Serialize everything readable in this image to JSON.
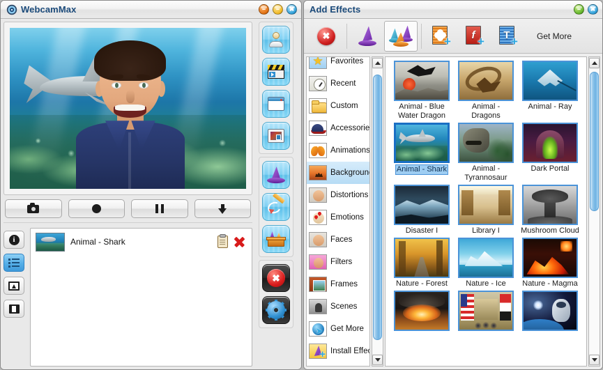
{
  "main_window": {
    "title": "WebcamMax",
    "logo_icon": "webcam-logo-icon",
    "window_buttons": [
      {
        "name": "minimize-button",
        "color": "#e06f10",
        "glyph": "–"
      },
      {
        "name": "maximize-button",
        "color": "#f0b824",
        "glyph": "–"
      },
      {
        "name": "close-button",
        "color": "#2f9fd8",
        "glyph": "✖"
      }
    ],
    "transport_buttons": [
      {
        "name": "snapshot-button",
        "icon": "camera-icon"
      },
      {
        "name": "record-button",
        "icon": "record-circle-icon"
      },
      {
        "name": "pause-button",
        "icon": "pause-icon"
      },
      {
        "name": "download-button",
        "icon": "arrow-down-icon"
      }
    ],
    "list_side_buttons": [
      {
        "name": "info-button",
        "icon": "info-icon",
        "active": false
      },
      {
        "name": "effects-list-button",
        "icon": "list-icon",
        "active": true
      },
      {
        "name": "image-button",
        "icon": "picture-icon",
        "active": false
      },
      {
        "name": "video-button",
        "icon": "film-icon",
        "active": false
      }
    ],
    "applied_effects": [
      {
        "name": "Animal - Shark",
        "thumb": "shark-thumb",
        "settings_icon": "clipboard-icon",
        "remove_icon": "red-x-icon"
      }
    ],
    "vertical_toolbar_groups": [
      [
        {
          "name": "avatar-button",
          "icon": "avatar-icon"
        },
        {
          "name": "video-clip-button",
          "icon": "clapperboard-icon"
        },
        {
          "name": "desktop-window-button",
          "icon": "window-icon"
        },
        {
          "name": "picture-in-picture-button",
          "icon": "frame-picture-icon"
        }
      ],
      [
        {
          "name": "effects-button",
          "icon": "magic-hat-icon"
        },
        {
          "name": "doodle-button",
          "icon": "pencil-icon"
        },
        {
          "name": "my-effects-button",
          "icon": "toolbox-icon"
        }
      ],
      [
        {
          "name": "stop-all-button",
          "icon": "red-stop-icon"
        },
        {
          "name": "settings-button",
          "icon": "gear-icon"
        }
      ]
    ]
  },
  "effects_window": {
    "title": "Add Effects",
    "window_buttons": [
      {
        "name": "minimize-button",
        "color": "#62b42a",
        "glyph": "–"
      },
      {
        "name": "close-button",
        "color": "#2f9fd8",
        "glyph": "✖"
      }
    ],
    "toolbar": {
      "items": [
        {
          "name": "clear-effects-button",
          "icon": "red-stop-icon",
          "selected": false
        },
        {
          "name": "single-effect-button",
          "icon": "single-hat-icon",
          "selected": false
        },
        {
          "name": "multi-effect-button",
          "icon": "multi-hat-icon",
          "selected": true
        },
        {
          "name": "add-picture-button",
          "icon": "add-image-icon",
          "selected": false
        },
        {
          "name": "add-flash-button",
          "icon": "add-flash-icon",
          "selected": false
        },
        {
          "name": "add-text-button",
          "icon": "add-text-icon",
          "selected": false
        }
      ],
      "get_more_label": "Get More"
    },
    "categories": [
      {
        "label": "Favorites",
        "icon": "star-icon",
        "active": false
      },
      {
        "label": "Recent",
        "icon": "clock-icon",
        "active": false
      },
      {
        "label": "Custom",
        "icon": "folder-icon",
        "active": false
      },
      {
        "label": "Accessories",
        "icon": "cap-icon",
        "active": false
      },
      {
        "label": "Animations",
        "icon": "butterfly-icon",
        "active": false
      },
      {
        "label": "Backgrounds",
        "icon": "desert-icon",
        "active": true
      },
      {
        "label": "Distortions",
        "icon": "face-icon",
        "active": false
      },
      {
        "label": "Emotions",
        "icon": "emotion-icon",
        "active": false
      },
      {
        "label": "Faces",
        "icon": "faces-icon",
        "active": false
      },
      {
        "label": "Filters",
        "icon": "filter-icon",
        "active": false
      },
      {
        "label": "Frames",
        "icon": "frame-icon",
        "active": false
      },
      {
        "label": "Scenes",
        "icon": "scene-icon",
        "active": false
      },
      {
        "label": "Get More",
        "icon": "globe-icon",
        "active": false
      },
      {
        "label": "Install Effects",
        "icon": "install-hat-icon",
        "active": false
      }
    ],
    "effects": [
      {
        "label": "Animal - Blue Water Dragon",
        "art": "a-dragon",
        "selected": false
      },
      {
        "label": "Animal - Dragons",
        "art": "a-dragons",
        "selected": false
      },
      {
        "label": "Animal - Ray",
        "art": "a-ray",
        "selected": false
      },
      {
        "label": "Animal - Shark",
        "art": "a-shark",
        "selected": true
      },
      {
        "label": "Animal - Tyrannosaur",
        "art": "a-trex",
        "selected": false
      },
      {
        "label": "Dark Portal",
        "art": "a-portal",
        "selected": false
      },
      {
        "label": "Disaster I",
        "art": "a-disaster",
        "selected": false
      },
      {
        "label": "Library I",
        "art": "a-library",
        "selected": false
      },
      {
        "label": "Mushroom Cloud",
        "art": "a-mush",
        "selected": false
      },
      {
        "label": "Nature - Forest",
        "art": "a-forest",
        "selected": false
      },
      {
        "label": "Nature - Ice",
        "art": "a-ice",
        "selected": false
      },
      {
        "label": "Nature - Magma",
        "art": "a-magma",
        "selected": false
      },
      {
        "label": "",
        "art": "a-nuke2",
        "selected": false
      },
      {
        "label": "",
        "art": "a-flags",
        "selected": false
      },
      {
        "label": "",
        "art": "a-space",
        "selected": false
      }
    ]
  },
  "colors": {
    "accent_blue": "#4b93d8",
    "selection_blue": "#9ecdf2",
    "title_text": "#1b4a7a",
    "window_bg": "#e8e8e8"
  }
}
